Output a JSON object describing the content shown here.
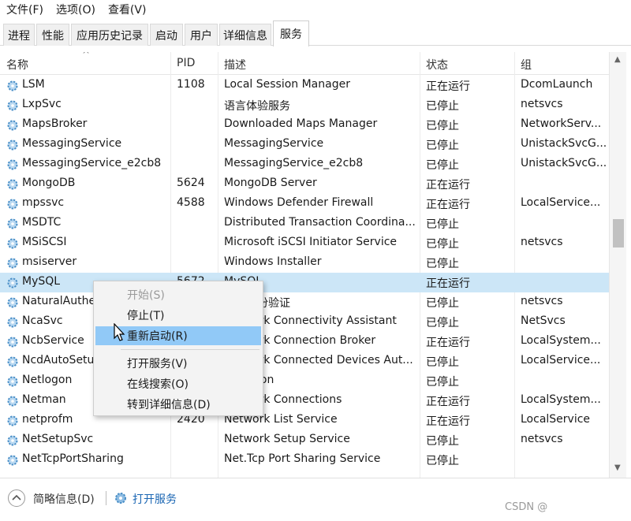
{
  "menu": [
    "文件(F)",
    "选项(O)",
    "查看(V)"
  ],
  "tabs": [
    "进程",
    "性能",
    "应用历史记录",
    "启动",
    "用户",
    "详细信息",
    "服务"
  ],
  "active_tab": "服务",
  "columns": {
    "name": "名称",
    "pid": "PID",
    "desc": "描述",
    "status": "状态",
    "group": "组"
  },
  "rows": [
    {
      "name": "LSM",
      "pid": "1108",
      "desc": "Local Session Manager",
      "status": "正在运行",
      "group": "DcomLaunch"
    },
    {
      "name": "LxpSvc",
      "pid": "",
      "desc": "语言体验服务",
      "status": "已停止",
      "group": "netsvcs"
    },
    {
      "name": "MapsBroker",
      "pid": "",
      "desc": "Downloaded Maps Manager",
      "status": "已停止",
      "group": "NetworkServ..."
    },
    {
      "name": "MessagingService",
      "pid": "",
      "desc": "MessagingService",
      "status": "已停止",
      "group": "UnistackSvcG..."
    },
    {
      "name": "MessagingService_e2cb8",
      "pid": "",
      "desc": "MessagingService_e2cb8",
      "status": "已停止",
      "group": "UnistackSvcG..."
    },
    {
      "name": "MongoDB",
      "pid": "5624",
      "desc": "MongoDB Server",
      "status": "正在运行",
      "group": ""
    },
    {
      "name": "mpssvc",
      "pid": "4588",
      "desc": "Windows Defender Firewall",
      "status": "正在运行",
      "group": "LocalService..."
    },
    {
      "name": "MSDTC",
      "pid": "",
      "desc": "Distributed Transaction Coordina...",
      "status": "已停止",
      "group": ""
    },
    {
      "name": "MSiSCSI",
      "pid": "",
      "desc": "Microsoft iSCSI Initiator Service",
      "status": "已停止",
      "group": "netsvcs"
    },
    {
      "name": "msiserver",
      "pid": "",
      "desc": "Windows Installer",
      "status": "已停止",
      "group": ""
    },
    {
      "name": "MySQL",
      "pid": "5672",
      "desc": "MySQL",
      "status": "正在运行",
      "group": ""
    },
    {
      "name": "NaturalAuthe",
      "pid": "",
      "desc": "自然身份验证",
      "status": "已停止",
      "group": "netsvcs"
    },
    {
      "name": "NcaSvc",
      "pid": "",
      "desc": "Network Connectivity Assistant",
      "status": "已停止",
      "group": "NetSvcs"
    },
    {
      "name": "NcbService",
      "pid": "",
      "desc": "Network Connection Broker",
      "status": "正在运行",
      "group": "LocalSystem..."
    },
    {
      "name": "NcdAutoSetu",
      "pid": "",
      "desc": "Network Connected Devices Aut...",
      "status": "已停止",
      "group": "LocalService..."
    },
    {
      "name": "Netlogon",
      "pid": "",
      "desc": "Netlogon",
      "status": "已停止",
      "group": ""
    },
    {
      "name": "Netman",
      "pid": "",
      "desc": "Network Connections",
      "status": "正在运行",
      "group": "LocalSystem..."
    },
    {
      "name": "netprofm",
      "pid": "2420",
      "desc": "Network List Service",
      "status": "正在运行",
      "group": "LocalService"
    },
    {
      "name": "NetSetupSvc",
      "pid": "",
      "desc": "Network Setup Service",
      "status": "已停止",
      "group": "netsvcs"
    },
    {
      "name": "NetTcpPortSharing",
      "pid": "",
      "desc": "Net.Tcp Port Sharing Service",
      "status": "已停止",
      "group": ""
    }
  ],
  "selected_row": "MySQL",
  "context_menu": {
    "start": "开始(S)",
    "stop": "停止(T)",
    "restart": "重新启动(R)",
    "open_services": "打开服务(V)",
    "search_online": "在线搜索(O)",
    "go_to_details": "转到详细信息(D)"
  },
  "footer": {
    "collapse_label": "简略信息(D)",
    "open_services_link": "打开服务"
  },
  "watermark": "CSDN @",
  "colors": {
    "selection": "#cce6f7",
    "menu_hover": "#91c9f7",
    "link": "#1a66b3",
    "gear": "#4a8fc7"
  }
}
